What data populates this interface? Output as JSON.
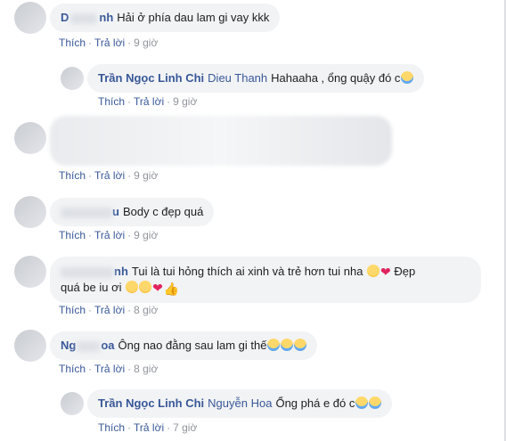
{
  "actions": {
    "like": "Thích",
    "reply": "Trả lời",
    "sep": "·"
  },
  "comments": [
    {
      "author_visible": "D",
      "author_tail": "nh",
      "text": "Hải ở phía dau lam gi vay kkk",
      "time": "9 giờ"
    },
    {
      "author": "Trần Ngọc Linh Chi",
      "mention": "Dieu Thanh",
      "text": "Hahaaha , ổng quậy đó c",
      "emoji": [
        "laugh"
      ],
      "time": "9 giờ"
    },
    {
      "text": "",
      "time": "9 giờ"
    },
    {
      "author_tail": "u",
      "text": "Body c đẹp quá",
      "time": "9 giờ"
    },
    {
      "author_tail": "nh",
      "text": "Tui là tui hỏng thích ai xinh và trẻ hơn tui nha",
      "text2": "Đẹp",
      "line2": "quá be iu ơi",
      "time": "8 giờ"
    },
    {
      "author_visible": "Ng",
      "author_tail": "oa",
      "text": "Ông nao đằng sau lam gi thế",
      "time": "8 giờ"
    },
    {
      "author": "Trần Ngọc Linh Chi",
      "mention": "Nguyễn Hoa",
      "text": "Ổng phá e đó c",
      "time": "7 giờ"
    }
  ]
}
